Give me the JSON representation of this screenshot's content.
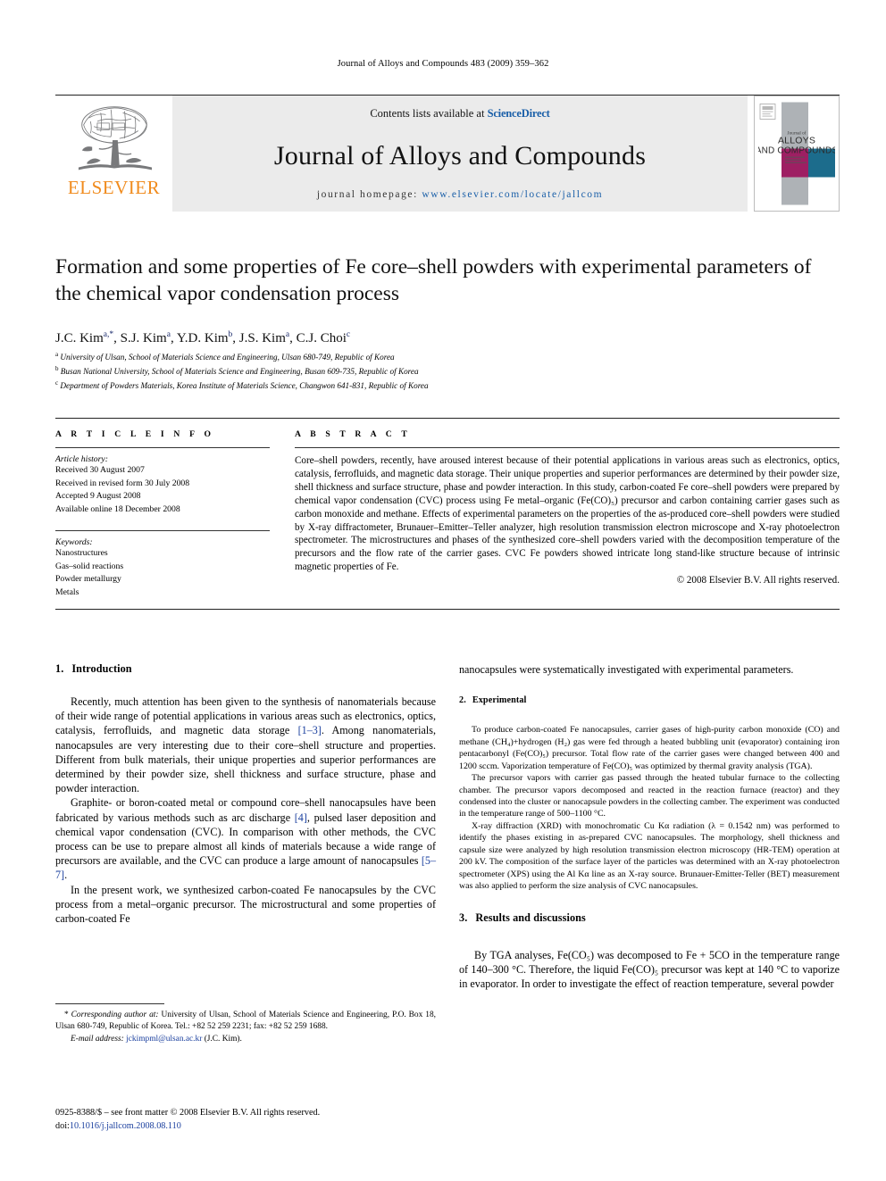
{
  "running_head": "Journal of Alloys and Compounds 483 (2009) 359–362",
  "masthead": {
    "publisher_name": "ELSEVIER",
    "contents_prefix": "Contents lists available at ",
    "contents_link": "ScienceDirect",
    "journal_title": "Journal of Alloys and Compounds",
    "homepage_prefix": "journal homepage: ",
    "homepage_url": "www.elsevier.com/locate/jallcom",
    "cover": {
      "line1": "Journal of",
      "line2": "ALLOYS",
      "line3": "AND COMPOUNDS"
    }
  },
  "article": {
    "title": "Formation and some properties of Fe core–shell powders with experimental parameters of the chemical vapor condensation process",
    "authors_html": "J.C. Kim<sup>a,</sup><sup>*</sup>, S.J. Kim<sup>a</sup>, Y.D. Kim<sup>b</sup>, J.S. Kim<sup>a</sup>, C.J. Choi<sup>c</sup>",
    "affiliations": [
      {
        "marker": "a",
        "text": "University of Ulsan, School of Materials Science and Engineering, Ulsan 680-749, Republic of Korea"
      },
      {
        "marker": "b",
        "text": "Busan National University, School of Materials Science and Engineering, Busan 609-735, Republic of Korea"
      },
      {
        "marker": "c",
        "text": "Department of Powders Materials, Korea Institute of Materials Science, Changwon 641-831, Republic of Korea"
      }
    ]
  },
  "article_info": {
    "heading": "A R T I C L E    I N F O",
    "history_label": "Article history:",
    "history": [
      "Received 30 August 2007",
      "Received in revised form 30 July 2008",
      "Accepted 9 August 2008",
      "Available online 18 December 2008"
    ],
    "keywords_label": "Keywords:",
    "keywords": [
      "Nanostructures",
      "Gas–solid reactions",
      "Powder metallurgy",
      "Metals"
    ]
  },
  "abstract": {
    "heading": "A B S T R A C T",
    "text": "Core–shell powders, recently, have aroused interest because of their potential applications in various areas such as electronics, optics, catalysis, ferrofluids, and magnetic data storage. Their unique properties and superior performances are determined by their powder size, shell thickness and surface structure, phase and powder interaction. In this study, carbon-coated Fe core–shell powders were prepared by chemical vapor condensation (CVC) process using Fe metal–organic (Fe(CO)₅) precursor and carbon containing carrier gases such as carbon monoxide and methane. Effects of experimental parameters on the properties of the as-produced core–shell powders were studied by X-ray diffractometer, Brunauer–Emitter–Teller analyzer, high resolution transmission electron microscope and X-ray photoelectron spectrometer. The microstructures and phases of the synthesized core–shell powders varied with the decomposition temperature of the precursors and the flow rate of the carrier gases. CVC Fe powders showed intricate long stand-like structure because of intrinsic magnetic properties of Fe.",
    "copyright": "© 2008 Elsevier B.V. All rights reserved."
  },
  "sections": {
    "intro": {
      "number": "1.",
      "title": "Introduction",
      "p1_a": "Recently, much attention has been given to the synthesis of nanomaterials because of their wide range of potential applications in various areas such as electronics, optics, catalysis, ferrofluids, and magnetic data storage ",
      "p1_ref": "[1–3]",
      "p1_b": ". Among nanomaterials, nanocapsules are very interesting due to their core–shell structure and properties. Different from bulk materials, their unique properties and superior performances are determined by their powder size, shell thickness and surface structure, phase and powder interaction.",
      "p2_a": "Graphite- or boron-coated metal or compound core–shell nanocapsules have been fabricated by various methods such as arc discharge ",
      "p2_ref1": "[4]",
      "p2_b": ", pulsed laser deposition and chemical vapor condensation (CVC). In comparison with other methods, the CVC process can be use to prepare almost all kinds of materials because a wide range of precursors are available, and the CVC can produce a large amount of nanocapsules ",
      "p2_ref2": "[5–7]",
      "p2_c": ".",
      "p3": "In the present work, we synthesized carbon-coated Fe nanocapsules by the CVC process from a metal–organic precursor. The microstructural and some properties of carbon-coated Fe",
      "p3_cont": "nanocapsules were systematically investigated with experimental parameters."
    },
    "experimental": {
      "number": "2.",
      "title": "Experimental",
      "p1": "To produce carbon-coated Fe nanocapsules, carrier gases of high-purity carbon monoxide (CO) and methane (CH₄)+hydrogen (H₂) gas were fed through a heated bubbling unit (evaporator) containing iron pentacarbonyl (Fe(CO)₅) precursor. Total flow rate of the carrier gases were changed between 400 and 1200 sccm. Vaporization temperature of Fe(CO)₅ was optimized by thermal gravity analysis (TGA).",
      "p2": "The precursor vapors with carrier gas passed through the heated tubular furnace to the collecting chamber. The precursor vapors decomposed and reacted in the reaction furnace (reactor) and they condensed into the cluster or nanocapsule powders in the collecting camber. The experiment was conducted in the temperature range of 500–1100 °C.",
      "p3": "X-ray diffraction (XRD) with monochromatic Cu Kα radiation (λ = 0.1542 nm) was performed to identify the phases existing in as-prepared CVC nanocapsules. The morphology, shell thickness and capsule size were analyzed by high resolution transmission electron microscopy (HR-TEM) operation at 200 kV. The composition of the surface layer of the particles was determined with an X-ray photoelectron spectrometer (XPS) using the Al Kα line as an X-ray source. Brunauer-Emitter-Teller (BET) measurement was also applied to perform the size analysis of CVC nanocapsules."
    },
    "results": {
      "number": "3.",
      "title": "Results and discussions",
      "p1": "By TGA analyses, Fe(CO₅) was decomposed to Fe + 5CO in the temperature range of 140–300 °C. Therefore, the liquid Fe(CO)₅ precursor was kept at 140 °C to vaporize in evaporator. In order to investigate the effect of reaction temperature, several powder"
    }
  },
  "footnotes": {
    "corresponding_star": "*",
    "corresponding_label": "Corresponding author at:",
    "corresponding_text": " University of Ulsan, School of Materials Science and Engineering, P.O. Box 18, Ulsan 680-749, Republic of Korea. Tel.: +82 52 259 2231; fax: +82 52 259 1688.",
    "email_label": "E-mail address:",
    "email": "jckimpml@ulsan.ac.kr",
    "email_suffix": " (J.C. Kim).",
    "issn_line": "0925-8388/$ – see front matter © 2008 Elsevier B.V. All rights reserved.",
    "doi_label": "doi:",
    "doi": "10.1016/j.jallcom.2008.08.110"
  },
  "colors": {
    "elsevier_orange": "#F08B1D",
    "link_blue": "#1a5fa8",
    "ref_blue": "#1a3f9e",
    "cover_magenta": "#9e1f63",
    "cover_teal": "#1c6c8c",
    "cover_gray": "#aeb2b6",
    "band_gray": "#ebebeb"
  }
}
